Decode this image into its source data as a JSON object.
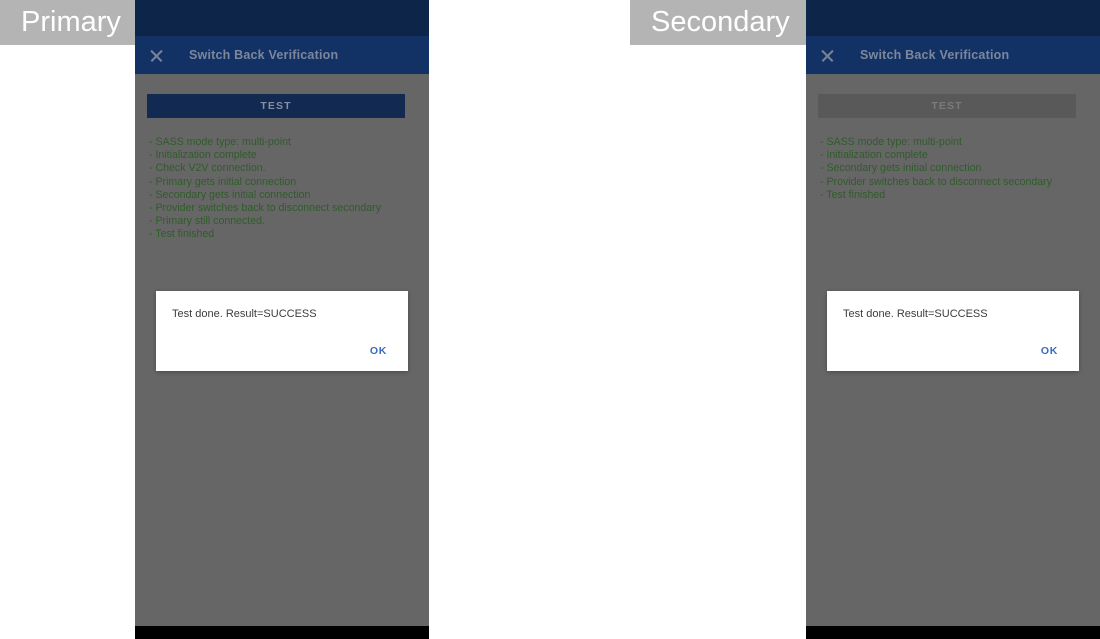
{
  "annotations": {
    "primary": "Primary",
    "secondary": "Secondary"
  },
  "colors": {
    "status_bar": "#0d2549",
    "app_bar": "#123265",
    "screen_scrim": "#666666",
    "log_text": "#2f5d2a",
    "button_enabled": "#122a52",
    "button_disabled": "#595959",
    "dialog_action": "#3b6bbf",
    "annotation_bg": "#b4b4b4",
    "nav_bar": "#000000"
  },
  "primary": {
    "app_bar": {
      "close_icon": "close-icon",
      "title": "Switch Back Verification"
    },
    "test_button": {
      "label": "TEST",
      "state": "enabled"
    },
    "log_lines": [
      "- SASS mode type: multi-point",
      "- Initialization complete",
      "- Check V2V connection.",
      "- Primary gets initial connection",
      "- Secondary gets initial connection",
      "- Provider switches back to disconnect secondary",
      "- Primary still connected.",
      "- Test finished"
    ],
    "dialog": {
      "message": "Test done. Result=SUCCESS",
      "ok_label": "OK"
    }
  },
  "secondary": {
    "app_bar": {
      "close_icon": "close-icon",
      "title": "Switch Back Verification"
    },
    "test_button": {
      "label": "TEST",
      "state": "disabled"
    },
    "log_lines": [
      "- SASS mode type: multi-point",
      "- Initialization complete",
      "- Secondary gets initial connection",
      "- Provider switches back to disconnect secondary",
      "- Test finished"
    ],
    "dialog": {
      "message": "Test done. Result=SUCCESS",
      "ok_label": "OK"
    }
  }
}
